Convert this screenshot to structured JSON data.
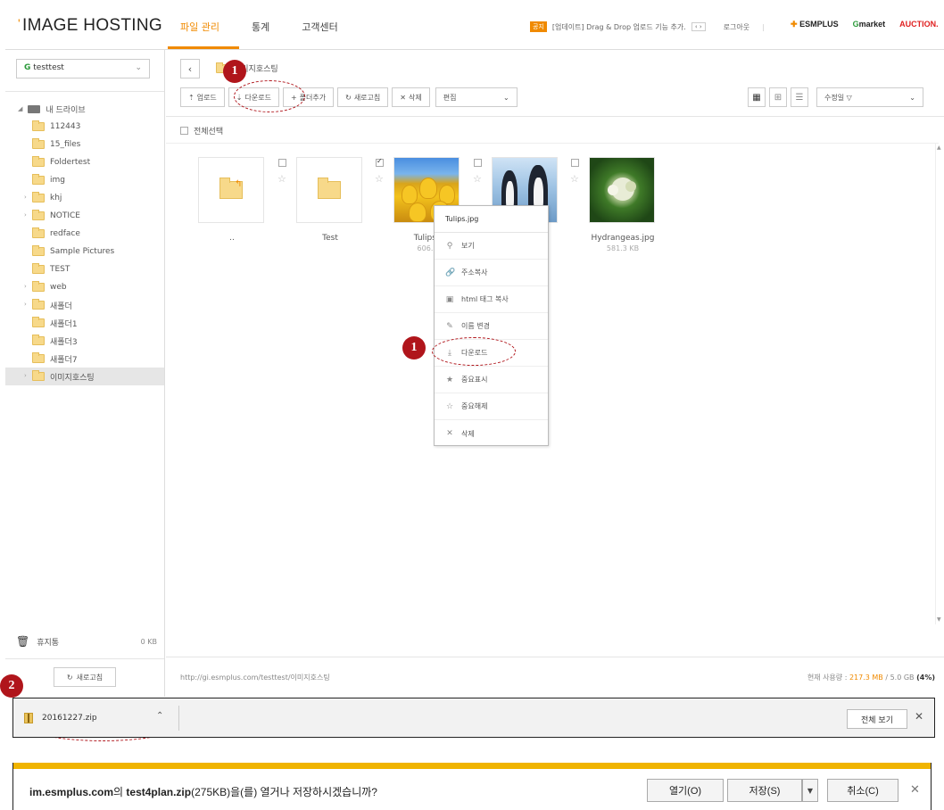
{
  "header": {
    "logo": "IMAGE HOSTING",
    "nav": [
      "파일 관리",
      "통계",
      "고객센터"
    ],
    "notice_badge": "공지",
    "notice_text": "[업데이트] Drag & Drop 업로드 기능 추가.",
    "notice_arrows": "‹ ›",
    "logout": "로그아웃",
    "brands": {
      "esmplus": "ESMPLUS",
      "gmarket_g": "G",
      "gmarket_rest": "market",
      "auction": "AUCTION."
    }
  },
  "sidebar": {
    "account_prefix": "G",
    "account": "testtest",
    "root": "내 드라이브",
    "folders": [
      "112443",
      "15_files",
      "Foldertest",
      "img",
      "khj",
      "NOTICE",
      "redface",
      "Sample Pictures",
      "TEST",
      "web",
      "새폴더",
      "새폴더1",
      "새폴더3",
      "새폴더7",
      "이미지호스팅"
    ],
    "trash_label": "휴지통",
    "trash_size": "0 KB",
    "refresh_label": "새로고침"
  },
  "main": {
    "breadcrumb": "이미지호스팅",
    "toolbar": {
      "upload": "업로드",
      "download": "다운로드",
      "add_folder": "폴더추가",
      "refresh": "새로고침",
      "delete": "삭제",
      "edit_select": "편집"
    },
    "sort_select": "수정일 ▽",
    "select_all": "전체선택",
    "items": [
      {
        "name": "..",
        "size": ""
      },
      {
        "name": "Test",
        "size": ""
      },
      {
        "name": "Tulips.jpg",
        "size": "606.3 KB"
      },
      {
        "name": "",
        "size": ""
      },
      {
        "name": "Hydrangeas.jpg",
        "size": "581.3 KB"
      }
    ],
    "tulips_name_visible": "Tulips.j",
    "tulips_size_visible": "606.3",
    "url": "http://gi.esmplus.com/testtest/이미지호스팅",
    "usage_label": "현재 사용량 :",
    "usage_used": "217.3 MB",
    "usage_total": "/ 5.0 GB",
    "usage_pct": "(4%)"
  },
  "context_menu": {
    "title": "Tulips.jpg",
    "items": [
      "보기",
      "주소복사",
      "html 태그 복사",
      "이름 변경",
      "다운로드",
      "중요표시",
      "중요해제",
      "삭제"
    ]
  },
  "markers": {
    "one": "1",
    "two": "2"
  },
  "download_bar": {
    "filename": "20161227.zip",
    "show_all": "전체 보기",
    "close": "✕"
  },
  "ie_bar": {
    "site": "im.esmplus.com",
    "mid1": "의 ",
    "file": "test4plan.zip",
    "mid2": "(275KB)을(를) 열거나 저장하시겠습니까?",
    "open": "열기(O)",
    "save": "저장(S)",
    "cancel": "취소(C)",
    "close": "✕"
  }
}
